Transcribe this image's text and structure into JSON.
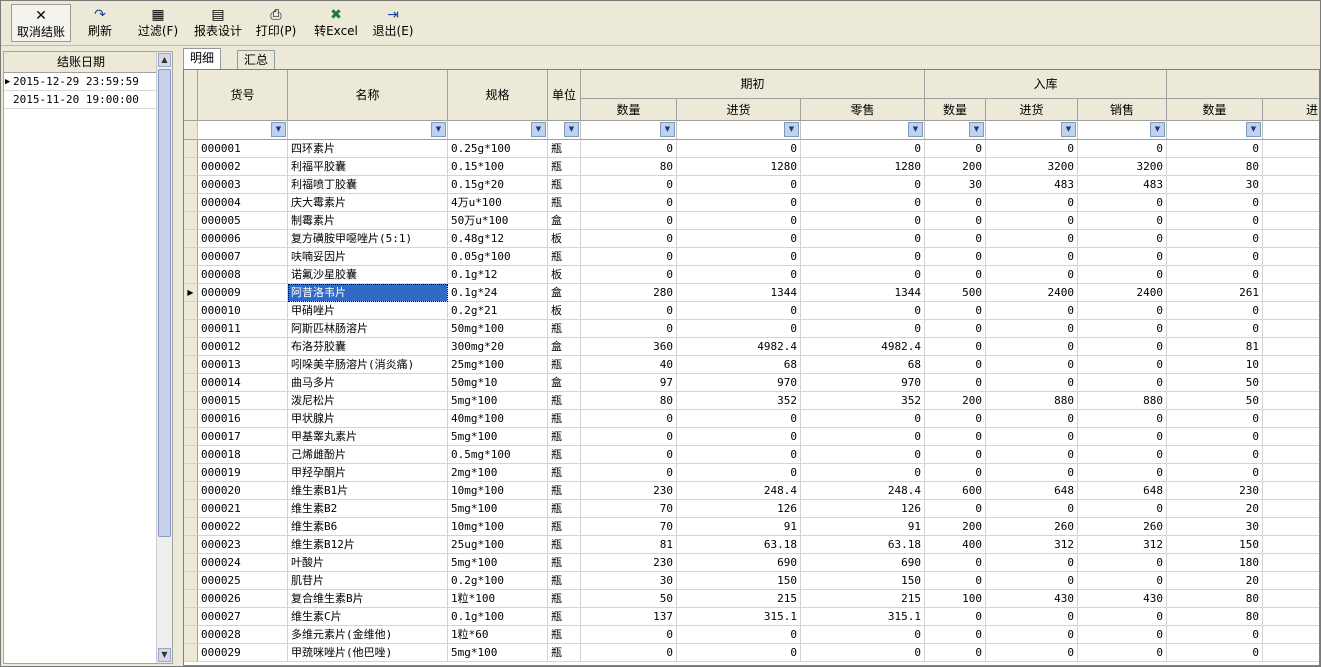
{
  "toolbar": {
    "buttons": [
      {
        "id": "cancel",
        "label": "取消结账",
        "icon": "close-icon",
        "glyph": "✕"
      },
      {
        "id": "refresh",
        "label": "刷新",
        "icon": "refresh-icon",
        "glyph": "↷"
      },
      {
        "id": "filter",
        "label": "过滤(F)",
        "icon": "filter-icon",
        "glyph": "▦"
      },
      {
        "id": "report",
        "label": "报表设计",
        "icon": "report-design-icon",
        "glyph": "▤"
      },
      {
        "id": "print",
        "label": "打印(P)",
        "icon": "printer-icon",
        "glyph": "⎙"
      },
      {
        "id": "excel",
        "label": "转Excel",
        "icon": "excel-icon",
        "glyph": "✖"
      },
      {
        "id": "exit",
        "label": "退出(E)",
        "icon": "exit-door-icon",
        "glyph": "⇥"
      }
    ]
  },
  "left_panel": {
    "header": "结账日期",
    "rows": [
      "2015-12-29 23:59:59",
      "2015-11-20 19:00:00"
    ],
    "current_row_marker": "▶"
  },
  "tabs": [
    {
      "label": "明细",
      "active": true
    },
    {
      "label": "汇总",
      "active": false
    }
  ],
  "grid": {
    "headers": {
      "code": "货号",
      "name": "名称",
      "spec": "规格",
      "unit": "单位",
      "group_opening": "期初",
      "group_inbound": "入库",
      "qty": "数量",
      "purchase": "进货",
      "retail": "零售",
      "sales": "销售",
      "partial_last": "进"
    },
    "filter_glyph": "▼",
    "current_row_marker": "▶",
    "selected_row": 8,
    "rows": [
      [
        "000001",
        "四环素片",
        "0.25g*100",
        "瓶",
        "0",
        "0",
        "0",
        "0",
        "0",
        "0",
        "0"
      ],
      [
        "000002",
        "利福平胶囊",
        "0.15*100",
        "瓶",
        "80",
        "1280",
        "1280",
        "200",
        "3200",
        "3200",
        "80"
      ],
      [
        "000003",
        "利福喷丁胶囊",
        "0.15g*20",
        "瓶",
        "0",
        "0",
        "0",
        "30",
        "483",
        "483",
        "30"
      ],
      [
        "000004",
        "庆大霉素片",
        "4万u*100",
        "瓶",
        "0",
        "0",
        "0",
        "0",
        "0",
        "0",
        "0"
      ],
      [
        "000005",
        "制霉素片",
        "50万u*100",
        "盒",
        "0",
        "0",
        "0",
        "0",
        "0",
        "0",
        "0"
      ],
      [
        "000006",
        "复方磺胺甲噁唑片(5:1)",
        "0.48g*12",
        "板",
        "0",
        "0",
        "0",
        "0",
        "0",
        "0",
        "0"
      ],
      [
        "000007",
        "呋喃妥因片",
        "0.05g*100",
        "瓶",
        "0",
        "0",
        "0",
        "0",
        "0",
        "0",
        "0"
      ],
      [
        "000008",
        "诺氟沙星胶囊",
        "0.1g*12",
        "板",
        "0",
        "0",
        "0",
        "0",
        "0",
        "0",
        "0"
      ],
      [
        "000009",
        "阿昔洛韦片",
        "0.1g*24",
        "盒",
        "280",
        "1344",
        "1344",
        "500",
        "2400",
        "2400",
        "261"
      ],
      [
        "000010",
        "甲硝唑片",
        "0.2g*21",
        "板",
        "0",
        "0",
        "0",
        "0",
        "0",
        "0",
        "0"
      ],
      [
        "000011",
        "阿斯匹林肠溶片",
        "50mg*100",
        "瓶",
        "0",
        "0",
        "0",
        "0",
        "0",
        "0",
        "0"
      ],
      [
        "000012",
        "布洛芬胶囊",
        "300mg*20",
        "盒",
        "360",
        "4982.4",
        "4982.4",
        "0",
        "0",
        "0",
        "81"
      ],
      [
        "000013",
        "吲哚美辛肠溶片(消炎痛)",
        "25mg*100",
        "瓶",
        "40",
        "68",
        "68",
        "0",
        "0",
        "0",
        "10"
      ],
      [
        "000014",
        "曲马多片",
        "50mg*10",
        "盒",
        "97",
        "970",
        "970",
        "0",
        "0",
        "0",
        "50"
      ],
      [
        "000015",
        "泼尼松片",
        "5mg*100",
        "瓶",
        "80",
        "352",
        "352",
        "200",
        "880",
        "880",
        "50"
      ],
      [
        "000016",
        "甲状腺片",
        "40mg*100",
        "瓶",
        "0",
        "0",
        "0",
        "0",
        "0",
        "0",
        "0"
      ],
      [
        "000017",
        "甲基睾丸素片",
        "5mg*100",
        "瓶",
        "0",
        "0",
        "0",
        "0",
        "0",
        "0",
        "0"
      ],
      [
        "000018",
        "己烯雌酚片",
        "0.5mg*100",
        "瓶",
        "0",
        "0",
        "0",
        "0",
        "0",
        "0",
        "0"
      ],
      [
        "000019",
        "甲羟孕酮片",
        "2mg*100",
        "瓶",
        "0",
        "0",
        "0",
        "0",
        "0",
        "0",
        "0"
      ],
      [
        "000020",
        "维生素B1片",
        "10mg*100",
        "瓶",
        "230",
        "248.4",
        "248.4",
        "600",
        "648",
        "648",
        "230"
      ],
      [
        "000021",
        "维生素B2",
        "5mg*100",
        "瓶",
        "70",
        "126",
        "126",
        "0",
        "0",
        "0",
        "20"
      ],
      [
        "000022",
        "维生素B6",
        "10mg*100",
        "瓶",
        "70",
        "91",
        "91",
        "200",
        "260",
        "260",
        "30"
      ],
      [
        "000023",
        "维生素B12片",
        "25ug*100",
        "瓶",
        "81",
        "63.18",
        "63.18",
        "400",
        "312",
        "312",
        "150"
      ],
      [
        "000024",
        "叶酸片",
        "5mg*100",
        "瓶",
        "230",
        "690",
        "690",
        "0",
        "0",
        "0",
        "180"
      ],
      [
        "000025",
        "肌苷片",
        "0.2g*100",
        "瓶",
        "30",
        "150",
        "150",
        "0",
        "0",
        "0",
        "20"
      ],
      [
        "000026",
        "复合维生素B片",
        "1粒*100",
        "瓶",
        "50",
        "215",
        "215",
        "100",
        "430",
        "430",
        "80"
      ],
      [
        "000027",
        "维生素C片",
        "0.1g*100",
        "瓶",
        "137",
        "315.1",
        "315.1",
        "0",
        "0",
        "0",
        "80"
      ],
      [
        "000028",
        "多维元素片(金维他)",
        "1粒*60",
        "瓶",
        "0",
        "0",
        "0",
        "0",
        "0",
        "0",
        "0"
      ],
      [
        "000029",
        "甲巯咪唑片(他巴唑)",
        "5mg*100",
        "瓶",
        "0",
        "0",
        "0",
        "0",
        "0",
        "0",
        "0"
      ]
    ]
  }
}
